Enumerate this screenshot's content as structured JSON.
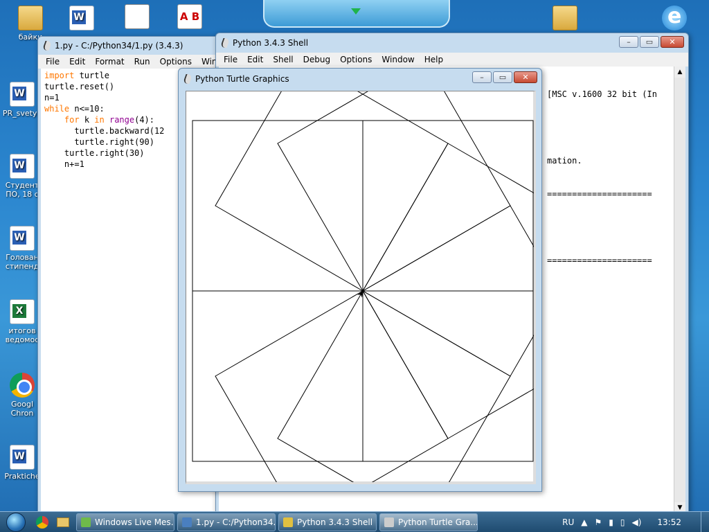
{
  "desktop": {
    "icons": [
      {
        "label": "байки",
        "kind": "folder"
      },
      {
        "label": "PR_svetya",
        "kind": "word"
      },
      {
        "label": "Студент ПО, 18 с",
        "kind": "word"
      },
      {
        "label": "Голован стипенд",
        "kind": "word"
      },
      {
        "label": "итогов ведомос",
        "kind": "excel"
      },
      {
        "label": "Googl Chron",
        "kind": "chrome"
      },
      {
        "label": "Praktiche",
        "kind": "word"
      }
    ],
    "top_icons": [
      "word",
      "doc",
      "abc",
      "folder",
      "ie"
    ],
    "abc_text": "A B C"
  },
  "editor": {
    "title": "1.py - C:/Python34/1.py (3.4.3)",
    "menu": [
      "File",
      "Edit",
      "Format",
      "Run",
      "Options",
      "Window"
    ],
    "code": [
      [
        {
          "t": "import",
          "c": "kw"
        },
        {
          "t": " turtle"
        }
      ],
      [
        {
          "t": "turtle.reset()"
        }
      ],
      [
        {
          "t": "n=1"
        }
      ],
      [
        {
          "t": "while",
          "c": "kw"
        },
        {
          "t": " n<=10:"
        }
      ],
      [
        {
          "t": "    "
        },
        {
          "t": "for",
          "c": "kw"
        },
        {
          "t": " k "
        },
        {
          "t": "in",
          "c": "kw"
        },
        {
          "t": " "
        },
        {
          "t": "range",
          "c": "bi"
        },
        {
          "t": "(4):"
        }
      ],
      [
        {
          "t": "      turtle.backward(12"
        }
      ],
      [
        {
          "t": "      turtle.right(90)"
        }
      ],
      [
        {
          "t": "    turtle.right(30)"
        }
      ],
      [
        {
          "t": "    n+=1"
        }
      ]
    ]
  },
  "shell": {
    "title": "Python 3.4.3 Shell",
    "menu": [
      "File",
      "Edit",
      "Shell",
      "Debug",
      "Options",
      "Window",
      "Help"
    ],
    "lines": [
      "[MSC v.1600 32 bit (In",
      "",
      "mation.",
      "=====================",
      "",
      "====================="
    ]
  },
  "turtle": {
    "title": "Python Turtle Graphics",
    "squares": 10,
    "side": 120,
    "turn_deg": 30,
    "stroke": "#000000"
  },
  "taskbar": {
    "items": [
      {
        "label": "Windows Live Mes...",
        "active": false
      },
      {
        "label": "1.py - C:/Python34...",
        "active": false
      },
      {
        "label": "Python 3.4.3 Shell",
        "active": false
      },
      {
        "label": "Python Turtle Gra...",
        "active": true
      }
    ],
    "lang": "RU",
    "clock": "13:52"
  },
  "colors": {
    "keyword": "#ff7700",
    "builtin": "#900090"
  }
}
